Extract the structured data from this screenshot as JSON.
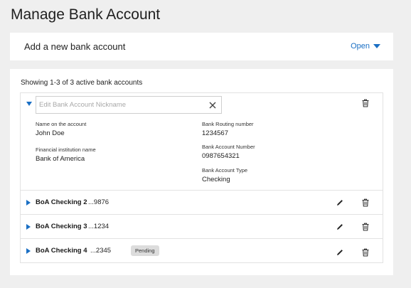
{
  "page_title": "Manage Bank Account",
  "add_card": {
    "label": "Add a new bank account",
    "open_label": "Open"
  },
  "list": {
    "showing_text": "Showing 1-3 of 3 active bank accounts",
    "expanded": {
      "nickname_placeholder": "Edit Bank Account Nickname",
      "nickname_value": "",
      "fields": {
        "name_label": "Name on the account",
        "name_value": "John Doe",
        "institution_label": "Financial institution name",
        "institution_value": "Bank of America",
        "routing_label": "Bank Routing number",
        "routing_value": "1234567",
        "account_number_label": "Bank Account Number",
        "account_number_value": "0987654321",
        "account_type_label": "Bank Account Type",
        "account_type_value": "Checking"
      }
    },
    "rows": [
      {
        "name": "BoA Checking 2",
        "mask": "...9876",
        "badge": ""
      },
      {
        "name": "BoA Checking 3",
        "mask": "...1234",
        "badge": ""
      },
      {
        "name": "BoA Checking 4",
        "mask": "...2345",
        "badge": "Pending"
      }
    ]
  },
  "colors": {
    "accent": "#1a6fc4",
    "background": "#efefef",
    "badge_bg": "#dcdcdc"
  },
  "icons": {
    "expand": "triangle-down-icon",
    "collapse": "triangle-right-icon",
    "clear": "close-icon",
    "edit": "pencil-icon",
    "delete": "trash-icon"
  }
}
